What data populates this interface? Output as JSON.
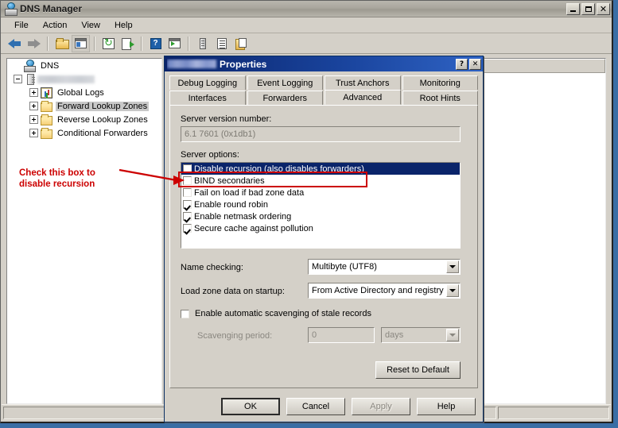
{
  "window": {
    "title": "DNS Manager",
    "icon": "dns-server-icon",
    "controls": {
      "minimize": "_",
      "maximize": "□",
      "close": "✕"
    }
  },
  "menu": {
    "items": [
      "File",
      "Action",
      "View",
      "Help"
    ]
  },
  "toolbar": {
    "buttons": [
      "back-arrow-icon",
      "forward-arrow-icon",
      "up-folder-icon",
      "show-hide-console-tree-icon",
      "refresh-icon",
      "export-list-icon",
      "help-icon",
      "new-window-icon",
      "server-icon",
      "properties-list-icon",
      "copy-icon"
    ]
  },
  "tree": {
    "root": {
      "label": "DNS",
      "icon": "dns-root-icon"
    },
    "server": {
      "label": "",
      "blurred": true,
      "icon": "server-icon"
    },
    "items": [
      {
        "label": "Global Logs",
        "icon": "global-logs-icon",
        "selected": false
      },
      {
        "label": "Forward Lookup Zones",
        "icon": "folder-icon",
        "selected": true
      },
      {
        "label": "Reverse Lookup Zones",
        "icon": "folder-icon",
        "selected": false
      },
      {
        "label": "Conditional Forwarders",
        "icon": "folder-icon",
        "selected": false
      }
    ]
  },
  "list_pane": {
    "columns": [
      "",
      ""
    ]
  },
  "statusbar": {
    "panels": [
      "",
      "",
      ""
    ]
  },
  "dialog": {
    "title_suffix": "Properties",
    "title_server_blurred": true,
    "help_button": "?",
    "close_button": "✕",
    "tabs_row1": [
      {
        "label": "Debug Logging",
        "active": false
      },
      {
        "label": "Event Logging",
        "active": false
      },
      {
        "label": "Trust Anchors",
        "active": false
      },
      {
        "label": "Monitoring",
        "active": false
      }
    ],
    "tabs_row2": [
      {
        "label": "Interfaces",
        "active": false
      },
      {
        "label": "Forwarders",
        "active": false
      },
      {
        "label": "Advanced",
        "active": true
      },
      {
        "label": "Root Hints",
        "active": false
      }
    ],
    "server_version_label": "Server version number:",
    "server_version_value": "6.1 7601 (0x1db1)",
    "server_options_label": "Server options:",
    "server_options": [
      {
        "label": "Disable recursion (also disables forwarders)",
        "checked": false,
        "selected": true
      },
      {
        "label": "BIND secondaries",
        "checked": false,
        "selected": false
      },
      {
        "label": "Fail on load if bad zone data",
        "checked": false,
        "selected": false
      },
      {
        "label": "Enable round robin",
        "checked": true,
        "selected": false
      },
      {
        "label": "Enable netmask ordering",
        "checked": true,
        "selected": false
      },
      {
        "label": "Secure cache against pollution",
        "checked": true,
        "selected": false
      }
    ],
    "name_checking_label": "Name checking:",
    "name_checking_value": "Multibyte (UTF8)",
    "load_zone_label": "Load zone data on startup:",
    "load_zone_value": "From Active Directory and registry",
    "scavenging_label": "Enable automatic scavenging of stale records",
    "scavenging_checked": false,
    "scavenging_period_label": "Scavenging period:",
    "scavenging_period_value": "0",
    "scavenging_period_unit": "days",
    "reset_button": "Reset to Default",
    "buttons": {
      "ok": "OK",
      "cancel": "Cancel",
      "apply": "Apply",
      "help": "Help"
    }
  },
  "annotation": {
    "line1": "Check this box to",
    "line2": "disable recursion",
    "color": "#cc0000"
  }
}
